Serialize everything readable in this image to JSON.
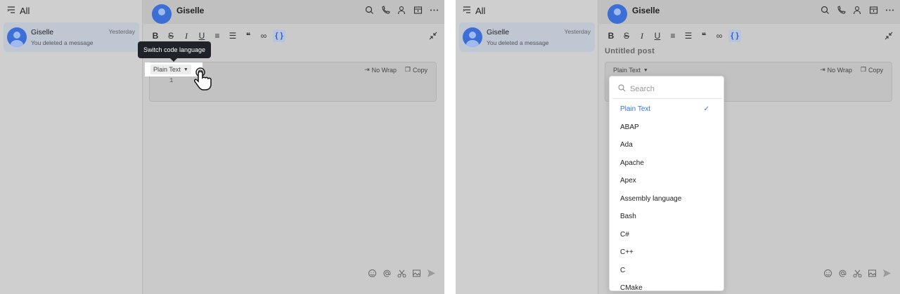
{
  "sidebar": {
    "filter_label": "All",
    "chat": {
      "name": "Giselle",
      "time": "Yesterday",
      "message": "You deleted a message"
    }
  },
  "header": {
    "name": "Giselle"
  },
  "editor": {
    "post_title_placeholder": "Untitled post",
    "code_block": {
      "language": "Plain Text",
      "no_wrap_label": "No Wrap",
      "copy_label": "Copy",
      "line_number": "1"
    }
  },
  "tooltip": {
    "text": "Switch code language"
  },
  "dropdown": {
    "search_placeholder": "Search",
    "items": [
      "Plain Text",
      "ABAP",
      "Ada",
      "Apache",
      "Apex",
      "Assembly language",
      "Bash",
      "C#",
      "C++",
      "C",
      "CMake"
    ],
    "selected": "Plain Text"
  },
  "colors": {
    "accent": "#3370ff",
    "tooltip_bg": "#1f2329",
    "avatar": "#3b6fd6"
  },
  "icons": [
    "list-filter-icon",
    "search-icon",
    "call-icon",
    "add-member-icon",
    "archive-icon",
    "more-icon",
    "collapse-icon",
    "emoji-icon",
    "at-icon",
    "scissors-icon",
    "image-icon",
    "send-icon",
    "check-icon",
    "hand-pointer-icon"
  ]
}
